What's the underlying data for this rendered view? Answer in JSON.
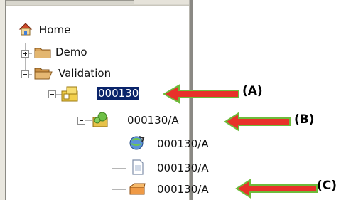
{
  "tree": {
    "home": {
      "label": "Home"
    },
    "demo": {
      "label": "Demo"
    },
    "validation": {
      "label": "Validation"
    },
    "study": {
      "label": "000130"
    },
    "substudy": {
      "label": "000130/A"
    },
    "children": [
      {
        "label": "000130/A",
        "icon": "globe-icon"
      },
      {
        "label": "000130/A",
        "icon": "document-icon"
      },
      {
        "label": "000130/A",
        "icon": "box-icon"
      }
    ]
  },
  "callouts": {
    "a": "(A)",
    "b": "(B)",
    "c": "(C)"
  },
  "colors": {
    "selection": "#0a246a",
    "arrow_fill": "#e8312a",
    "arrow_outline": "#6dbb3a"
  }
}
